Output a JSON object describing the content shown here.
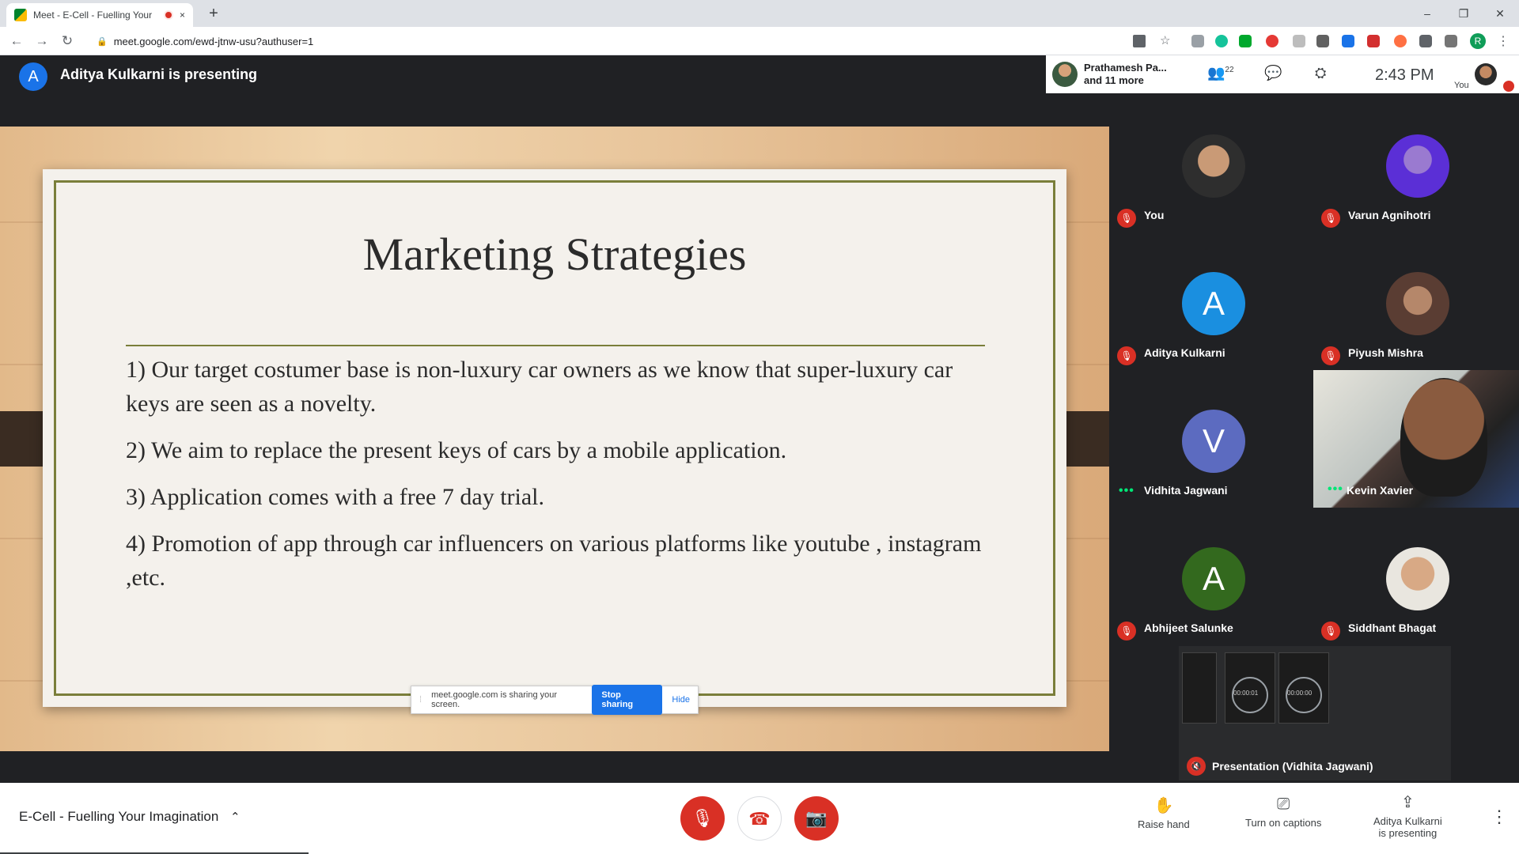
{
  "browser": {
    "tab_title": "Meet - E-Cell - Fuelling Your",
    "tab_close": "×",
    "new_tab": "+",
    "url": "meet.google.com/ewd-jtnw-usu?authuser=1",
    "win_min": "–",
    "win_max": "❐",
    "win_close": "✕",
    "back": "←",
    "forward": "→",
    "reload": "↻",
    "profile_initial": "R"
  },
  "meet": {
    "presenter_initial": "A",
    "presenter_text": "Aditya Kulkarni is presenting",
    "people_name": "Prathamesh Pa...",
    "people_more": "and 11 more",
    "participants_count": "22",
    "time": "2:43 PM",
    "you_label": "You"
  },
  "slide": {
    "title": "Marketing Strategies",
    "bullets": [
      "1) Our target costumer base is non-luxury car owners as we know that super-luxury car keys are seen as a novelty.",
      "2) We aim to replace the present keys of cars by a mobile application.",
      "3) Application comes with a free 7 day trial.",
      "4) Promotion of app through car influencers on various platforms like youtube , instagram ,etc."
    ]
  },
  "share_bar": {
    "message": "meet.google.com is sharing your screen.",
    "stop": "Stop sharing",
    "hide": "Hide"
  },
  "tiles": [
    {
      "name": "You",
      "initial": "",
      "color": "",
      "status": "muted"
    },
    {
      "name": "Varun Agnihotri",
      "initial": "",
      "color": "#5b2fd6",
      "status": "muted"
    },
    {
      "name": "Aditya Kulkarni",
      "initial": "A",
      "color": "#1a8fe0",
      "status": "muted"
    },
    {
      "name": "Piyush Mishra",
      "initial": "",
      "color": "",
      "status": "muted"
    },
    {
      "name": "Vidhita Jagwani",
      "initial": "V",
      "color": "#5c6bc0",
      "status": "speaking"
    },
    {
      "name": "Kevin Xavier",
      "initial": "",
      "color": "",
      "status": "speaking"
    },
    {
      "name": "Abhijeet Salunke",
      "initial": "A",
      "color": "#33691e",
      "status": "muted"
    },
    {
      "name": "Siddhant Bhagat",
      "initial": "",
      "color": "",
      "status": "muted"
    }
  ],
  "presentation_tile": {
    "label": "Presentation (Vidhita Jagwani)",
    "timer_left": "00:00:01",
    "timer_right": "00:00:00"
  },
  "bottom": {
    "meeting_name": "E-Cell - Fuelling Your Imagination",
    "raise_hand": "Raise hand",
    "captions": "Turn on captions",
    "presenting_line1": "Aditya Kulkarni",
    "presenting_line2": "is presenting",
    "more": "⋮",
    "chevron": "⌃"
  }
}
